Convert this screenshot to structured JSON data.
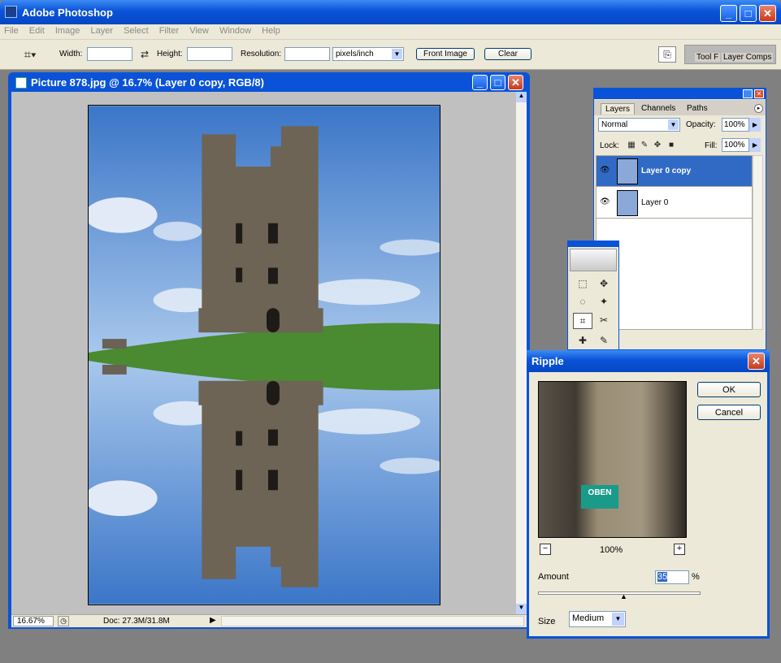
{
  "app": {
    "title": "Adobe Photoshop"
  },
  "menu": [
    "File",
    "Edit",
    "Image",
    "Layer",
    "Select",
    "Filter",
    "View",
    "Window",
    "Help"
  ],
  "options": {
    "width_label": "Width:",
    "height_label": "Height:",
    "resolution_label": "Resolution:",
    "units": "pixels/inch",
    "front_image": "Front Image",
    "clear": "Clear",
    "tool_presets": "Tool F",
    "layer_comps": "Layer Comps"
  },
  "document": {
    "title": "Picture 878.jpg @ 16.7% (Layer 0 copy, RGB/8)",
    "zoom": "16.67%",
    "doc_size": "Doc: 27.3M/31.8M"
  },
  "layers_panel": {
    "tabs": [
      "Layers",
      "Channels",
      "Paths"
    ],
    "blend_mode": "Normal",
    "opacity_label": "Opacity:",
    "opacity": "100%",
    "lock_label": "Lock:",
    "fill_label": "Fill:",
    "fill": "100%",
    "layers": [
      {
        "name": "Layer 0 copy",
        "selected": true
      },
      {
        "name": "Layer 0",
        "selected": false
      }
    ]
  },
  "ripple": {
    "title": "Ripple",
    "ok": "OK",
    "cancel": "Cancel",
    "zoom": "100%",
    "amount_label": "Amount",
    "amount": "35",
    "percent": "%",
    "size_label": "Size",
    "size": "Medium",
    "preview_sign": "OBEN"
  },
  "colors": {
    "titlebar": "#0a53d8",
    "selection": "#316ac5",
    "chrome": "#ece9d8"
  }
}
